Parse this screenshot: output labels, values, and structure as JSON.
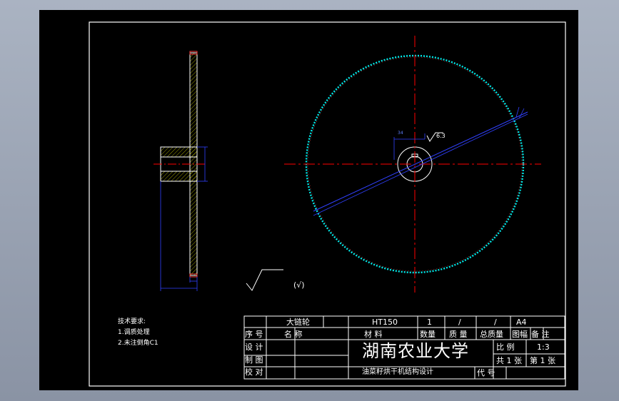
{
  "notes": {
    "heading": "技术要求:",
    "items": [
      "1.调质处理",
      "2.未注倒角C1"
    ]
  },
  "dims": {
    "roughness_main": "6.3",
    "roughness_general": "(√)"
  },
  "title_block": {
    "part_name": "大链轮",
    "material": "HT150",
    "quantity": "1",
    "weight": "/",
    "total_weight": "/",
    "paper_size": "A4",
    "headers": {
      "seq": "序 号",
      "name": "名 称",
      "material": "材 料",
      "quantity": "数量",
      "weight": "质 量",
      "total_weight": "总质量",
      "sheet_size": "图幅",
      "remarks": "备 注"
    },
    "roles": [
      "设 计",
      "制 图",
      "校 对"
    ],
    "school": "湖南农业大学",
    "project": "油菜籽烘干机结构设计",
    "scale_label": "比 例",
    "scale_value": "1:3",
    "sheets": "共 1 张",
    "sheet_no": "第 1 张",
    "code_label": "代 号"
  },
  "colors": {
    "outline": "#ffffff",
    "centerline": "#ff0000",
    "dimension": "#0000ff",
    "teeth": "#00ffff",
    "hatch": "#ffff00",
    "text": "#ffffff"
  }
}
